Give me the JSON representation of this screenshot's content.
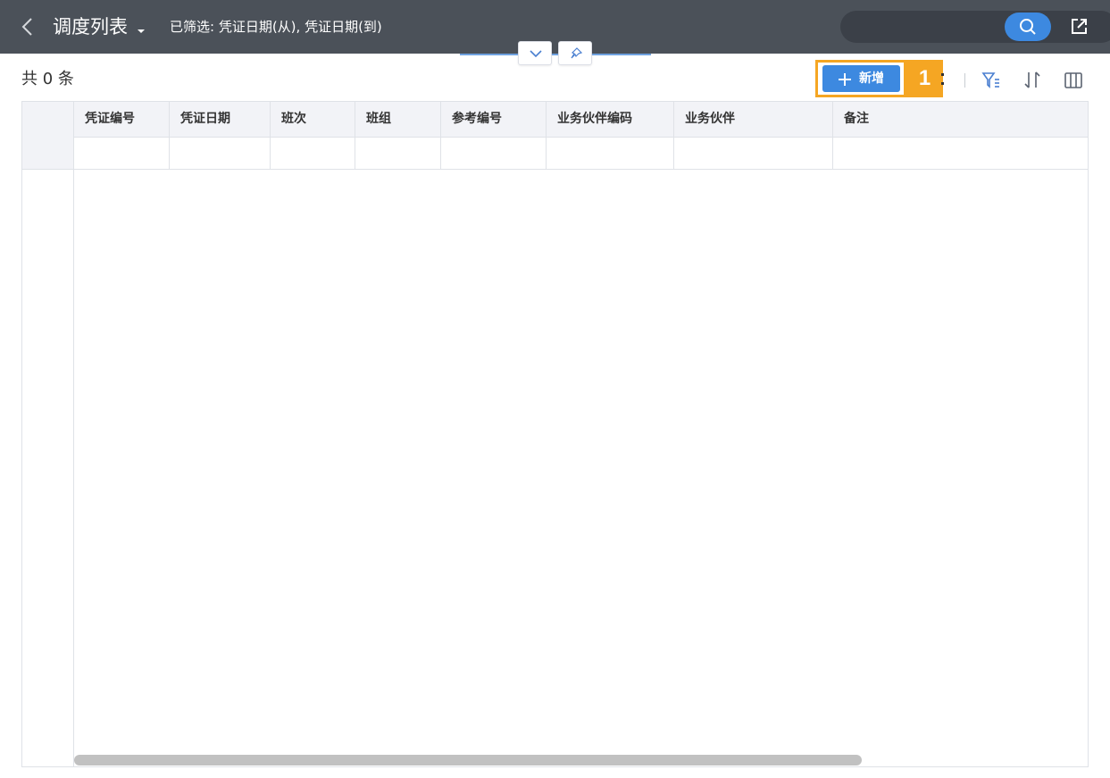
{
  "header": {
    "title": "调度列表",
    "filter_text": "已筛选: 凭证日期(从), 凭证日期(到)",
    "search": {
      "value": "",
      "placeholder": ""
    },
    "icons": [
      "back-icon",
      "caret-down-icon",
      "search-icon",
      "export-icon"
    ]
  },
  "panel_buttons": {
    "icons": [
      "chevron-down-icon",
      "pin-icon"
    ]
  },
  "toolbar": {
    "count_text": "共 0 条",
    "add_label": "新增",
    "step_number": "1",
    "icons": [
      "more-icon",
      "filter-icon",
      "sort-icon",
      "columns-icon"
    ]
  },
  "table": {
    "columns": [
      "凭证编号",
      "凭证日期",
      "班次",
      "班组",
      "参考编号",
      "业务伙伴编码",
      "业务伙伴",
      "备注"
    ],
    "rows": []
  },
  "colors": {
    "header_bg": "#4b5159",
    "accent": "#3d89e0",
    "highlight": "#f5a623",
    "table_header_bg": "#f2f3f7"
  }
}
